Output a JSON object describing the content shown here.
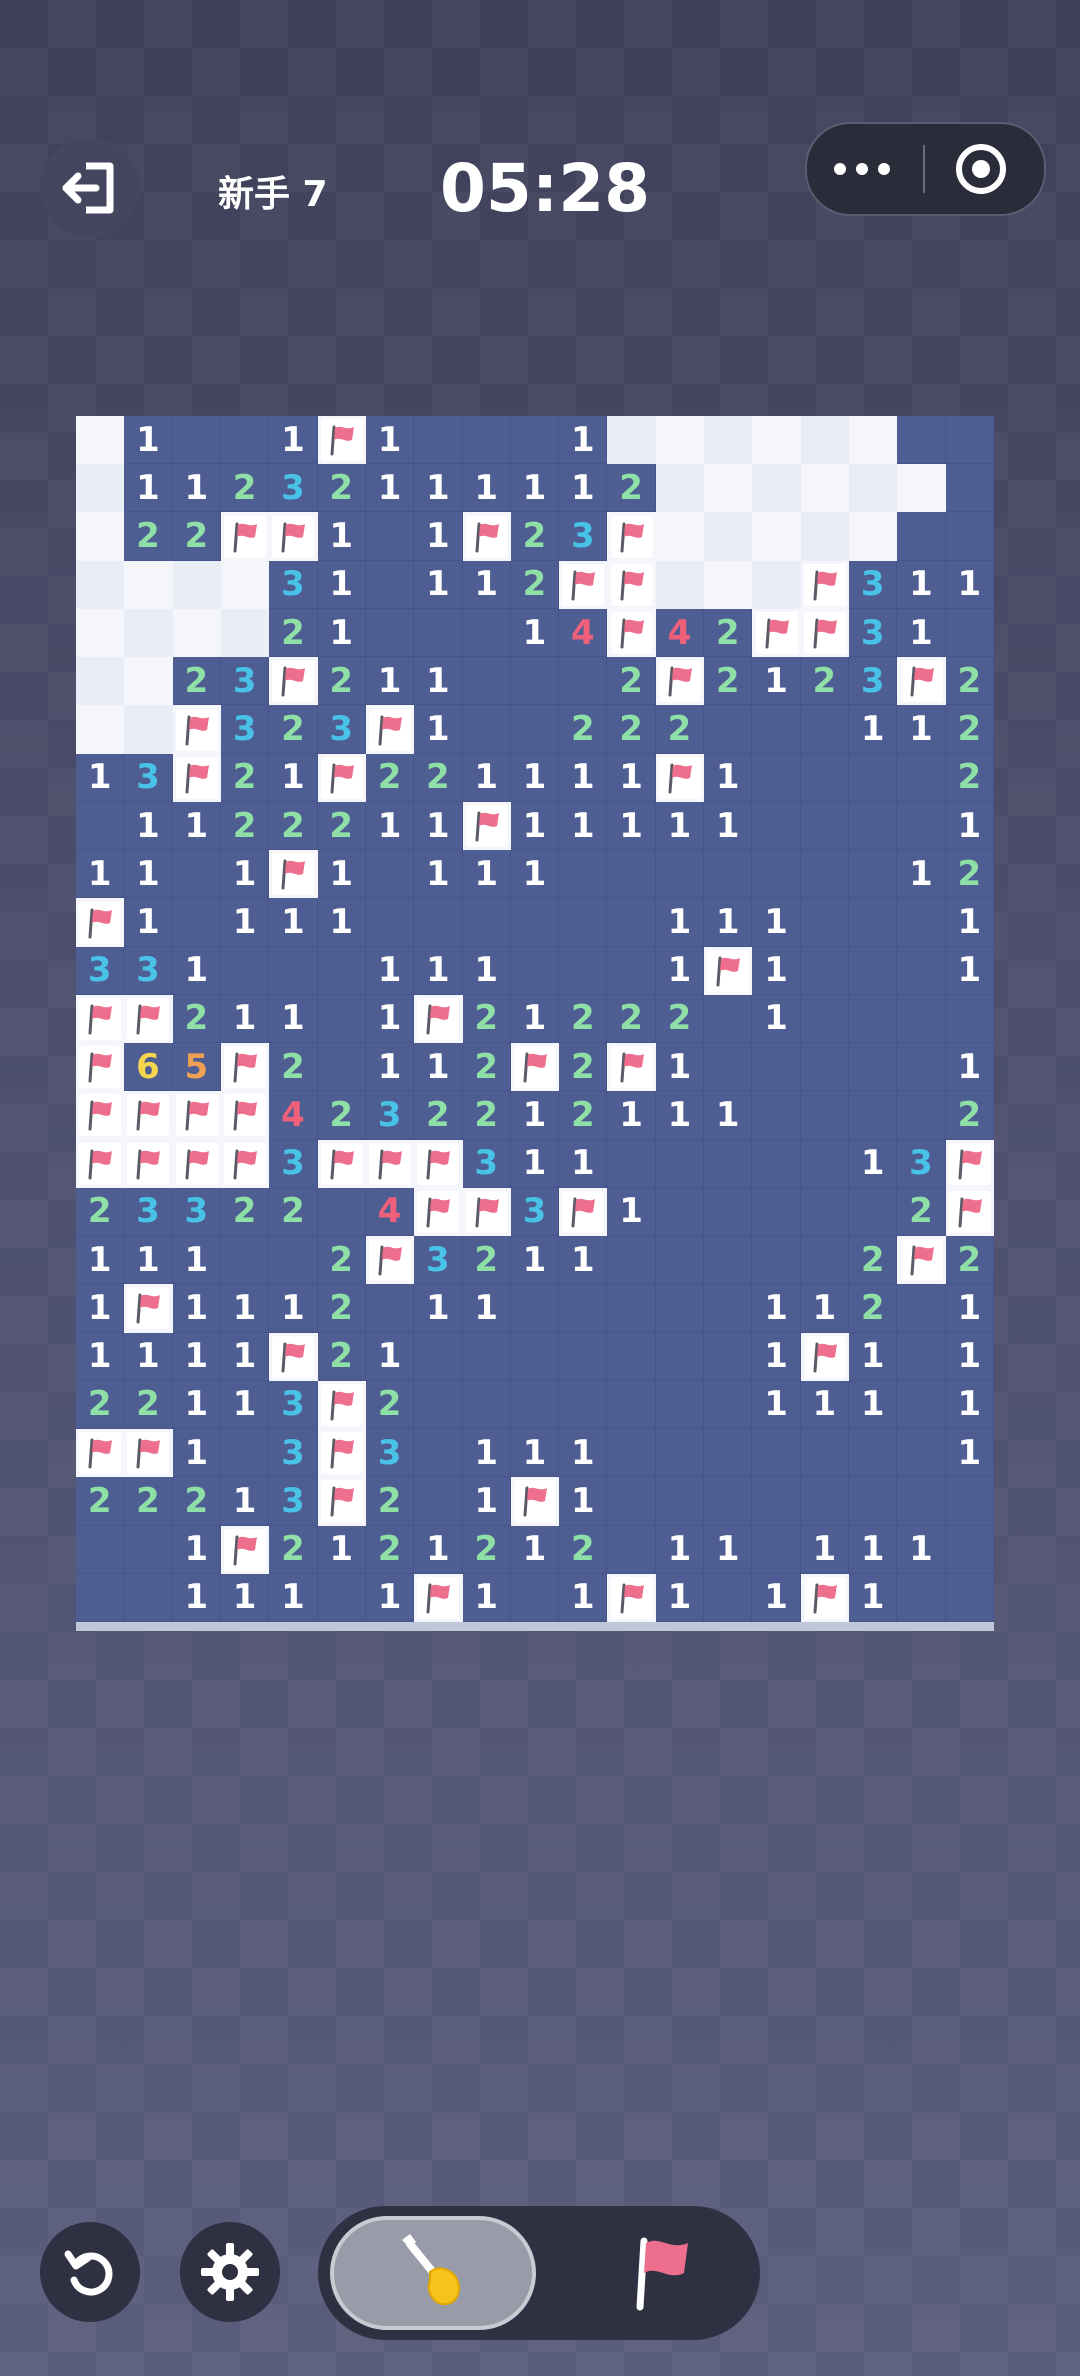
{
  "header": {
    "level": "新手 7",
    "timer": "05:28",
    "exit_icon": "exit-icon",
    "menu_icon": "more-icon",
    "close_icon": "target-icon"
  },
  "toolbar": {
    "undo_icon": "undo-icon",
    "settings_icon": "gear-icon",
    "mode_options": [
      "dig",
      "flag"
    ],
    "selected_mode": "dig"
  },
  "colors": {
    "open_cell": "#4e5d92",
    "covered_cell": "#f4f6fb",
    "flag": "#ee6f8d",
    "n1": "#ffffff",
    "n2": "#8ee0a6",
    "n3": "#49c2e8",
    "n4": "#f0607a",
    "n5": "#f0a052",
    "n6": "#f5d64e"
  },
  "board": {
    "rows": [
      "#1..1F1...1######",
      "#11232111112######",
      "#22FF1.1F23F#####",
      "####31.112FF###F311",
      "####21...14F42FF31.",
      "##23F211...2F2123F21",
      "##F323F1..222...112F",
      "13F21F221111F1....22",
      ".1122211F11111....1F",
      "11.1F1.111.......122",
      "F1.111......111...1F2",
      "331...111...1F1...13F",
      "FF211.1F21222 1....3F",
      "F65F2.112F2F1.....13F",
      "FFFF4232212111....2F3",
      "FFFF3FFF311.....13F2",
      "23322 4FF3F1.....2F31",
      "111..2F3211.....2F2.",
      "1F1112 11.....112 11.",
      "1111F21.......1F1.11",
      "22113F2.......111.1F",
      "FF1.3F3.111.......11",
      "22213F2.1F1.........",
      "..1F2121212 11.111..",
      "..111.1F1.1F1.1F1..."
    ]
  }
}
